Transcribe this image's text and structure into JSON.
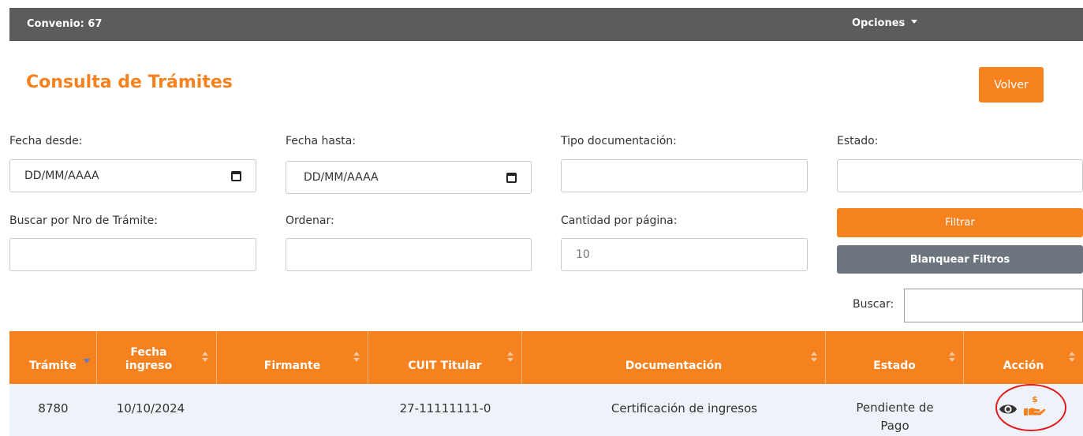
{
  "topbar": {
    "convenio_label": "Convenio:",
    "convenio_value": "67",
    "opciones_label": "Opciones"
  },
  "page": {
    "title": "Consulta de Trámites",
    "back_label": "Volver"
  },
  "filters": {
    "fecha_desde_label": "Fecha desde:",
    "fecha_desde_value": "DD/MM/AAAA",
    "fecha_hasta_label": "Fecha hasta:",
    "fecha_hasta_value": "DD/MM/AAAA",
    "tipo_doc_label": "Tipo documentación:",
    "tipo_doc_value": "",
    "estado_label": "Estado:",
    "estado_value": "",
    "nro_tramite_label": "Buscar por Nro de Trámite:",
    "nro_tramite_value": "",
    "ordenar_label": "Ordenar:",
    "ordenar_value": "",
    "cantidad_label": "Cantidad por página:",
    "cantidad_placeholder": "10",
    "filtrar_label": "Filtrar",
    "blanquear_label": "Blanquear Filtros"
  },
  "search": {
    "label": "Buscar:",
    "value": ""
  },
  "table": {
    "columns": [
      "Trámite",
      "Fecha ingreso",
      "Firmante",
      "CUIT Titular",
      "Documentación",
      "Estado",
      "Acción"
    ],
    "rows": [
      {
        "tramite": "8780",
        "fecha": "10/10/2024",
        "firmante": "",
        "cuit": "27-11111111-0",
        "documentacion": "Certificación de ingresos",
        "estado": "Pendiente de Pago",
        "actions": [
          "eye-icon",
          "pay-hand-icon"
        ]
      }
    ]
  },
  "colors": {
    "accent": "#f5821f",
    "topbar": "#5c5c5c",
    "secondary": "#6c757d",
    "highlight": "#e31a1a"
  }
}
